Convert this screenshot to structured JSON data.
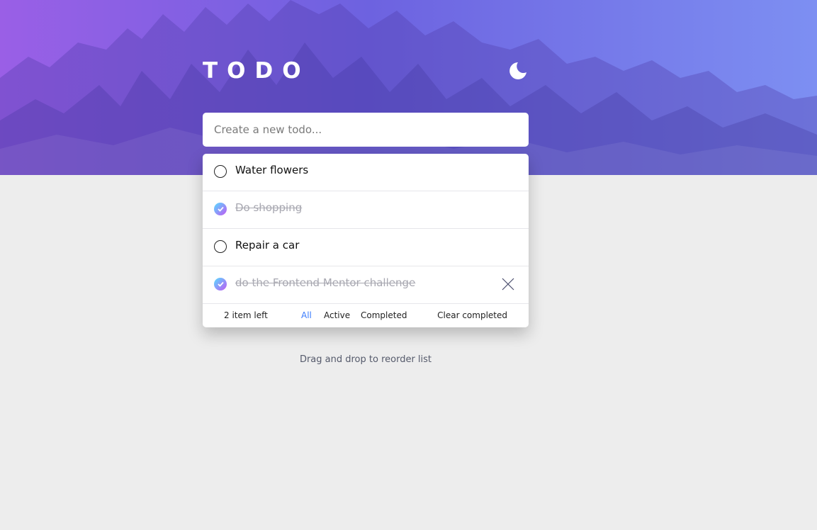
{
  "app": {
    "title": "TODO",
    "theme_icon": "moon-icon"
  },
  "new_todo": {
    "placeholder": "Create a new todo..."
  },
  "todos": [
    {
      "text": "Water flowers",
      "completed": false
    },
    {
      "text": "Do shopping",
      "completed": true
    },
    {
      "text": "Repair a car",
      "completed": false
    },
    {
      "text": "do the Frontend Mentor challenge",
      "completed": true
    }
  ],
  "footer": {
    "items_left": "2 item left",
    "filters": {
      "all": "All",
      "active": "Active",
      "completed": "Completed"
    },
    "active_filter": "All",
    "clear_completed": "Clear completed"
  },
  "hint": "Drag and drop to reorder list",
  "colors": {
    "accent": "#3a7bfd",
    "check_gradient_start": "#57ddff",
    "check_gradient_end": "#c058f3",
    "page_background": "#ededed"
  }
}
